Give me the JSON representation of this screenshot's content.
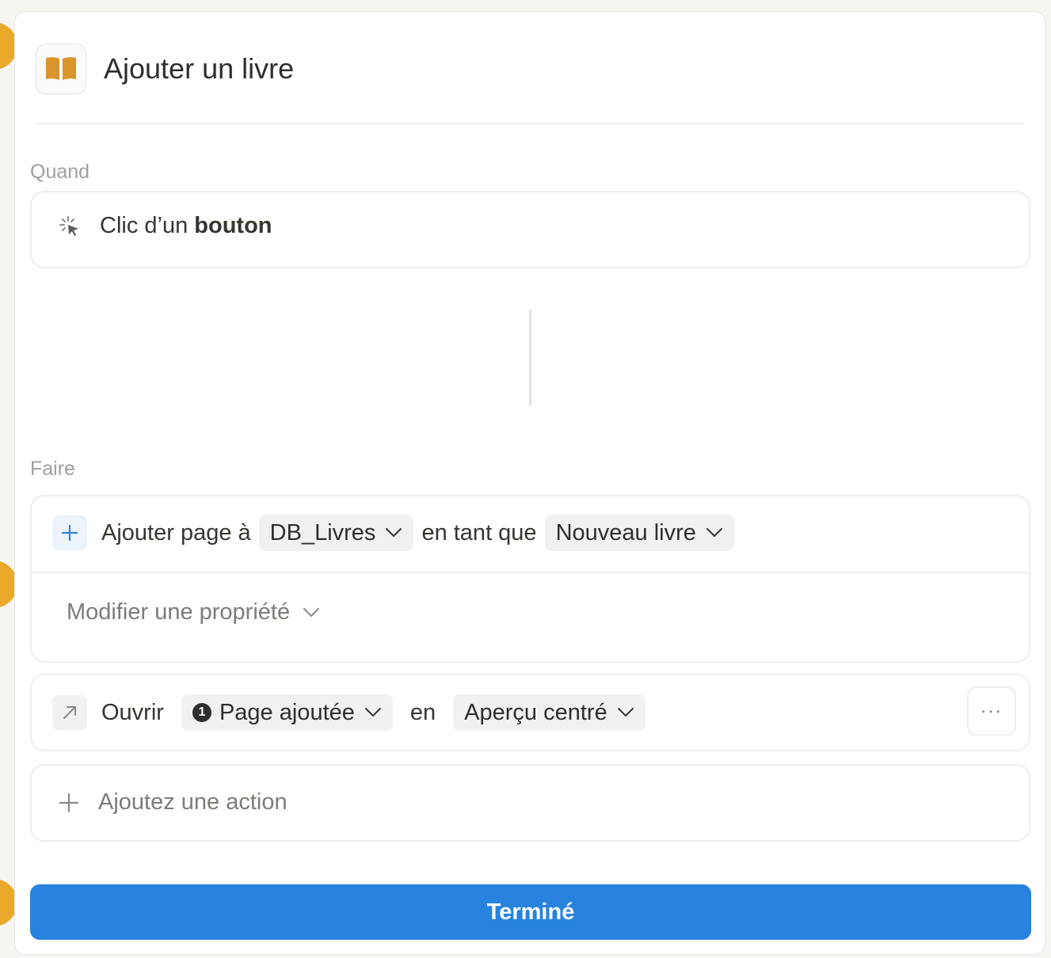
{
  "header": {
    "title": "Ajouter un livre",
    "icon": "open-book-icon",
    "icon_color": "#d9952c"
  },
  "trigger": {
    "label": "Quand",
    "text_prefix": "Clic d’un ",
    "text_bold": "bouton",
    "icon": "cursor-click-icon"
  },
  "actions": {
    "label": "Faire",
    "add_page": {
      "icon": "plus-icon",
      "prefix": "Ajouter page à",
      "database": "DB_Livres",
      "middle": "en tant que",
      "template": "Nouveau livre",
      "modify_property": "Modifier une propriété"
    },
    "open": {
      "icon": "arrow-up-right-icon",
      "verb": "Ouvrir",
      "badge_number": "1",
      "target": "Page ajoutée",
      "middle": "en",
      "mode": "Aperçu centré",
      "more": "···"
    },
    "add_action": "Ajoutez une action"
  },
  "done_button": "Terminé",
  "colors": {
    "accent_blue": "#2783de",
    "book_icon": "#d9952c",
    "side_tab": "#e9a92b"
  }
}
